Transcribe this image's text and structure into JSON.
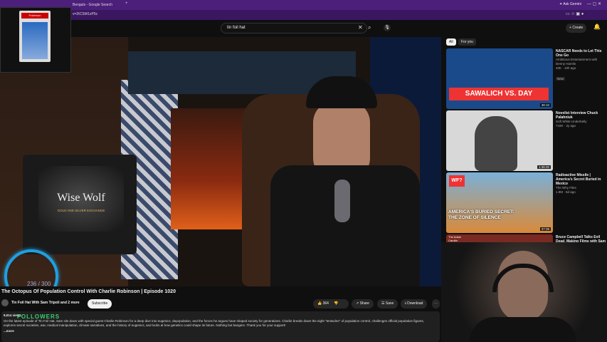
{
  "browser": {
    "tabs": [
      "Bengals - Google Search"
    ],
    "address": "v=2tCSW1sP5c",
    "ask_gemini": "Ask Gemini"
  },
  "youtube": {
    "search_value": "tin foil hat",
    "create_label": "Create"
  },
  "overlay": {
    "card_label": "Pokémon",
    "followers_count": "236 / 300",
    "followers_label": "FOLLOWERS"
  },
  "video": {
    "title": "The Octopus Of Population Control With Charlie Robinson | Episode 1020",
    "channel": "Tin Foil Hat With Sam Tripoli and 2 more",
    "subscribe": "Subscribe",
    "likes": "364",
    "share": "Share",
    "save": "Save",
    "download": "Download",
    "views": "9,014 views",
    "description": "On the latest episode of Tin Foil Hat, Sam sits down with special guest Charlie Robinson for a deep dive into eugenics, depopulation, and the forces he argues have shaped society for generations. Charlie breaks down the eight \"tentacles\" of population control, challenges official population figures, explores secret societies, war, medical manipulation, climate narratives, and the history of eugenics, and looks at how genetics could shape its future. Nothing but bangers. Thank you for your support!",
    "more": "...more"
  },
  "scene": {
    "sign_line1": "Wise Wolf",
    "sign_line2": "GOLD AND SILVER EXCHANGE"
  },
  "sidebar": {
    "chips": [
      "All",
      "For you"
    ],
    "videos": [
      {
        "title": "NASCAR Needs to Let This One Go",
        "channel": "Ambitious Entertainment with Denny Hamlin",
        "meta": "40K · 10h ago",
        "badge": "New",
        "thumb_text": "SAWALICH VS. DAY",
        "duration": "38:10",
        "bg": "#1b4a8a"
      },
      {
        "title": "Novelist Interview Chuck Palahniuk",
        "channel": "Soft White Underbelly",
        "meta": "743K · 2y ago",
        "badge": "",
        "thumb_text": "",
        "duration": "1:36:20",
        "bg": "#dcdcdc"
      },
      {
        "title": "Radioactive Missile | America's Secret Buried in Mexico",
        "channel": "The Why Files",
        "meta": "1.9M · 6d ago",
        "badge": "",
        "thumb_text": "AMERICA'S BURIED SECRET: THE ZONE OF SILENCE",
        "duration": "37:39",
        "bg": "#d98a3a"
      },
      {
        "title": "Bruce Campbell Talks Evil Dead, Making Films with Sam Raimi, and Gives Cancer Diagnosis Update",
        "channel": "",
        "meta": "",
        "badge": "",
        "thumb_text": "The Adam Carolla Show",
        "duration": "",
        "bg": "#7a2a22"
      }
    ]
  },
  "colors": {
    "accent": "#cc0000",
    "browser_purple": "#4b1f7a"
  }
}
